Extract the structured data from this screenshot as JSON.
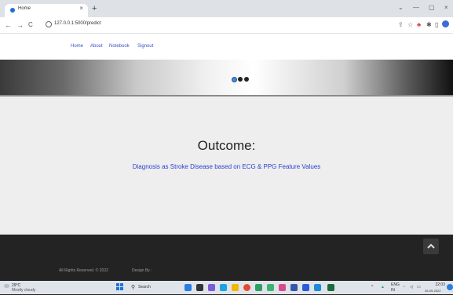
{
  "browser": {
    "tab_title": "Home",
    "tab_close": "×",
    "new_tab": "+",
    "url": "127.0.0.1:5000/predict",
    "back": "←",
    "forward": "→",
    "reload": "C",
    "win_min": "—",
    "win_max": "▢",
    "win_close": "×",
    "win_chevron": "⌄"
  },
  "nav": {
    "links": [
      "Home",
      "About",
      "Notebook",
      "Signout"
    ]
  },
  "carousel": {
    "active_index": 0,
    "count": 3
  },
  "main": {
    "title": "Outcome:",
    "result": "Diagnosis as Stroke Disease based on ECG & PPG Feature Values"
  },
  "footer": {
    "rights": "All Rights Reserved. © 2022",
    "design": "Design By :"
  },
  "taskbar": {
    "temp": "29°C",
    "weather": "Mostly cloudy",
    "search": "Search",
    "lang": "ENG",
    "lang2": "IN",
    "time": "22:03",
    "date": "26-09-2022"
  },
  "colors": {
    "link": "#3b53c6",
    "result_text": "#2a3fd0",
    "footer_bg": "#232323",
    "page_bg": "#eeeeee"
  }
}
